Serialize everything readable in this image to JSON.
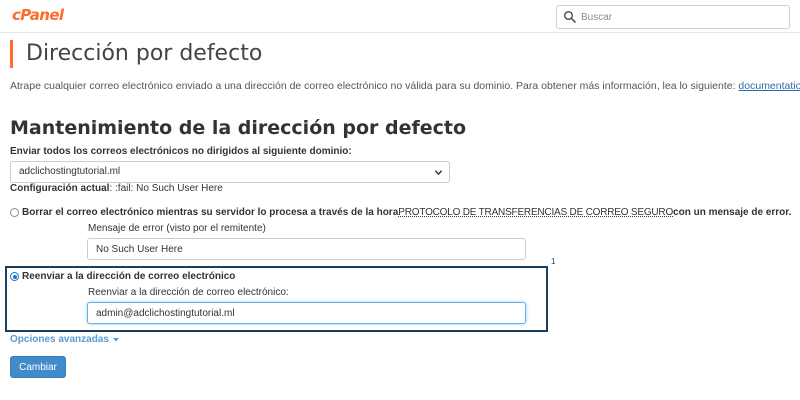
{
  "header": {
    "logo_text": "cPanel",
    "search": {
      "placeholder": "Buscar",
      "icon": "search-icon"
    }
  },
  "page": {
    "title": "Dirección por defecto",
    "intro_text": "Atrape cualquier correo electrónico enviado a una dirección de correo electrónico no válida para su dominio. Para obtener más información, lea lo siguiente: ",
    "intro_link": "documentation",
    "intro_end": "."
  },
  "form": {
    "section_title": "Mantenimiento de la dirección por defecto",
    "domain_label": "Enviar todos los correos electrónicos no dirigidos al siguiente dominio:",
    "domain_selected": "adclichostingtutorial.ml",
    "current_config_label": "Configuración actual",
    "current_config_value": ": :fail: No Such User Here",
    "option_discard": {
      "label_before": "Borrar el correo electrónico mientras su servidor lo procesa a través de la hora ",
      "label_smtp": "PROTOCOLO DE TRANSFERENCIAS DE CORREO SEGURO",
      "label_after": " con un mensaje de error.",
      "checked": false,
      "error_label": "Mensaje de error (visto por el remitente)",
      "error_value": "No Such User Here"
    },
    "option_forward": {
      "label": "Reenviar a la dirección de correo electrónico",
      "checked": true,
      "address_label": "Reenviar a la dirección de correo electrónico:",
      "address_value": "admin@adclichostingtutorial.ml"
    },
    "callout_number": "1",
    "advanced_label": "Opciones avanzadas",
    "submit_label": "Cambiar"
  },
  "colors": {
    "brand_orange": "#ff6c2c",
    "link_blue": "#2d6ea8",
    "primary_button": "#428bca",
    "highlight_border": "#1b3f5e"
  }
}
